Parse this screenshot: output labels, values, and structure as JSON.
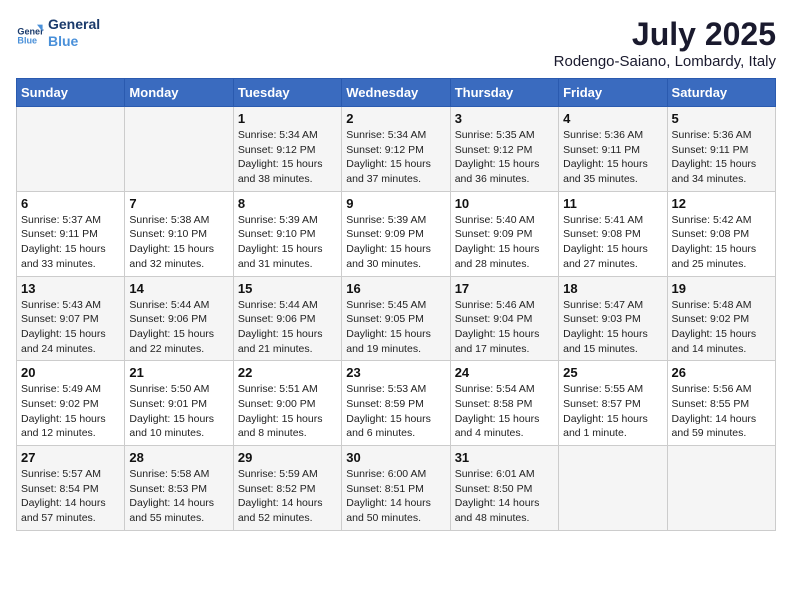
{
  "header": {
    "logo_line1": "General",
    "logo_line2": "Blue",
    "month": "July 2025",
    "location": "Rodengo-Saiano, Lombardy, Italy"
  },
  "weekdays": [
    "Sunday",
    "Monday",
    "Tuesday",
    "Wednesday",
    "Thursday",
    "Friday",
    "Saturday"
  ],
  "weeks": [
    [
      {
        "day": "",
        "info": ""
      },
      {
        "day": "",
        "info": ""
      },
      {
        "day": "1",
        "info": "Sunrise: 5:34 AM\nSunset: 9:12 PM\nDaylight: 15 hours and 38 minutes."
      },
      {
        "day": "2",
        "info": "Sunrise: 5:34 AM\nSunset: 9:12 PM\nDaylight: 15 hours and 37 minutes."
      },
      {
        "day": "3",
        "info": "Sunrise: 5:35 AM\nSunset: 9:12 PM\nDaylight: 15 hours and 36 minutes."
      },
      {
        "day": "4",
        "info": "Sunrise: 5:36 AM\nSunset: 9:11 PM\nDaylight: 15 hours and 35 minutes."
      },
      {
        "day": "5",
        "info": "Sunrise: 5:36 AM\nSunset: 9:11 PM\nDaylight: 15 hours and 34 minutes."
      }
    ],
    [
      {
        "day": "6",
        "info": "Sunrise: 5:37 AM\nSunset: 9:11 PM\nDaylight: 15 hours and 33 minutes."
      },
      {
        "day": "7",
        "info": "Sunrise: 5:38 AM\nSunset: 9:10 PM\nDaylight: 15 hours and 32 minutes."
      },
      {
        "day": "8",
        "info": "Sunrise: 5:39 AM\nSunset: 9:10 PM\nDaylight: 15 hours and 31 minutes."
      },
      {
        "day": "9",
        "info": "Sunrise: 5:39 AM\nSunset: 9:09 PM\nDaylight: 15 hours and 30 minutes."
      },
      {
        "day": "10",
        "info": "Sunrise: 5:40 AM\nSunset: 9:09 PM\nDaylight: 15 hours and 28 minutes."
      },
      {
        "day": "11",
        "info": "Sunrise: 5:41 AM\nSunset: 9:08 PM\nDaylight: 15 hours and 27 minutes."
      },
      {
        "day": "12",
        "info": "Sunrise: 5:42 AM\nSunset: 9:08 PM\nDaylight: 15 hours and 25 minutes."
      }
    ],
    [
      {
        "day": "13",
        "info": "Sunrise: 5:43 AM\nSunset: 9:07 PM\nDaylight: 15 hours and 24 minutes."
      },
      {
        "day": "14",
        "info": "Sunrise: 5:44 AM\nSunset: 9:06 PM\nDaylight: 15 hours and 22 minutes."
      },
      {
        "day": "15",
        "info": "Sunrise: 5:44 AM\nSunset: 9:06 PM\nDaylight: 15 hours and 21 minutes."
      },
      {
        "day": "16",
        "info": "Sunrise: 5:45 AM\nSunset: 9:05 PM\nDaylight: 15 hours and 19 minutes."
      },
      {
        "day": "17",
        "info": "Sunrise: 5:46 AM\nSunset: 9:04 PM\nDaylight: 15 hours and 17 minutes."
      },
      {
        "day": "18",
        "info": "Sunrise: 5:47 AM\nSunset: 9:03 PM\nDaylight: 15 hours and 15 minutes."
      },
      {
        "day": "19",
        "info": "Sunrise: 5:48 AM\nSunset: 9:02 PM\nDaylight: 15 hours and 14 minutes."
      }
    ],
    [
      {
        "day": "20",
        "info": "Sunrise: 5:49 AM\nSunset: 9:02 PM\nDaylight: 15 hours and 12 minutes."
      },
      {
        "day": "21",
        "info": "Sunrise: 5:50 AM\nSunset: 9:01 PM\nDaylight: 15 hours and 10 minutes."
      },
      {
        "day": "22",
        "info": "Sunrise: 5:51 AM\nSunset: 9:00 PM\nDaylight: 15 hours and 8 minutes."
      },
      {
        "day": "23",
        "info": "Sunrise: 5:53 AM\nSunset: 8:59 PM\nDaylight: 15 hours and 6 minutes."
      },
      {
        "day": "24",
        "info": "Sunrise: 5:54 AM\nSunset: 8:58 PM\nDaylight: 15 hours and 4 minutes."
      },
      {
        "day": "25",
        "info": "Sunrise: 5:55 AM\nSunset: 8:57 PM\nDaylight: 15 hours and 1 minute."
      },
      {
        "day": "26",
        "info": "Sunrise: 5:56 AM\nSunset: 8:55 PM\nDaylight: 14 hours and 59 minutes."
      }
    ],
    [
      {
        "day": "27",
        "info": "Sunrise: 5:57 AM\nSunset: 8:54 PM\nDaylight: 14 hours and 57 minutes."
      },
      {
        "day": "28",
        "info": "Sunrise: 5:58 AM\nSunset: 8:53 PM\nDaylight: 14 hours and 55 minutes."
      },
      {
        "day": "29",
        "info": "Sunrise: 5:59 AM\nSunset: 8:52 PM\nDaylight: 14 hours and 52 minutes."
      },
      {
        "day": "30",
        "info": "Sunrise: 6:00 AM\nSunset: 8:51 PM\nDaylight: 14 hours and 50 minutes."
      },
      {
        "day": "31",
        "info": "Sunrise: 6:01 AM\nSunset: 8:50 PM\nDaylight: 14 hours and 48 minutes."
      },
      {
        "day": "",
        "info": ""
      },
      {
        "day": "",
        "info": ""
      }
    ]
  ]
}
